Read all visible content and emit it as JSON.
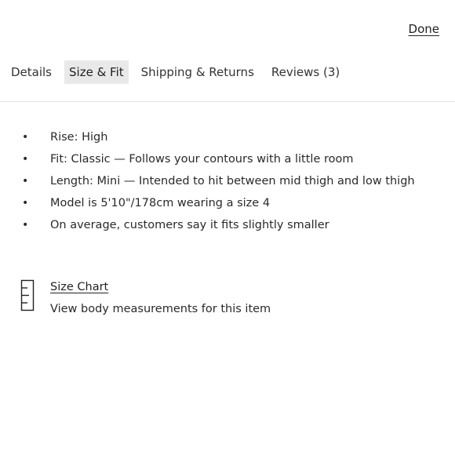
{
  "header": {
    "done_label": "Done"
  },
  "tabs": [
    {
      "label": "Details",
      "active": false
    },
    {
      "label": "Size & Fit",
      "active": true
    },
    {
      "label": "Shipping & Returns",
      "active": false
    },
    {
      "label": "Reviews (3)",
      "active": false
    }
  ],
  "fit_details": [
    "Rise: High",
    "Fit: Classic — Follows your contours with a little room",
    "Length: Mini — Intended to hit between mid thigh and low thigh",
    "Model is 5'10\"/178cm wearing a size 4",
    "On average, customers say it fits slightly smaller"
  ],
  "bullet_char": "•",
  "size_chart": {
    "icon": "ruler-icon",
    "link_label": "Size Chart",
    "description": "View body measurements for this item"
  }
}
